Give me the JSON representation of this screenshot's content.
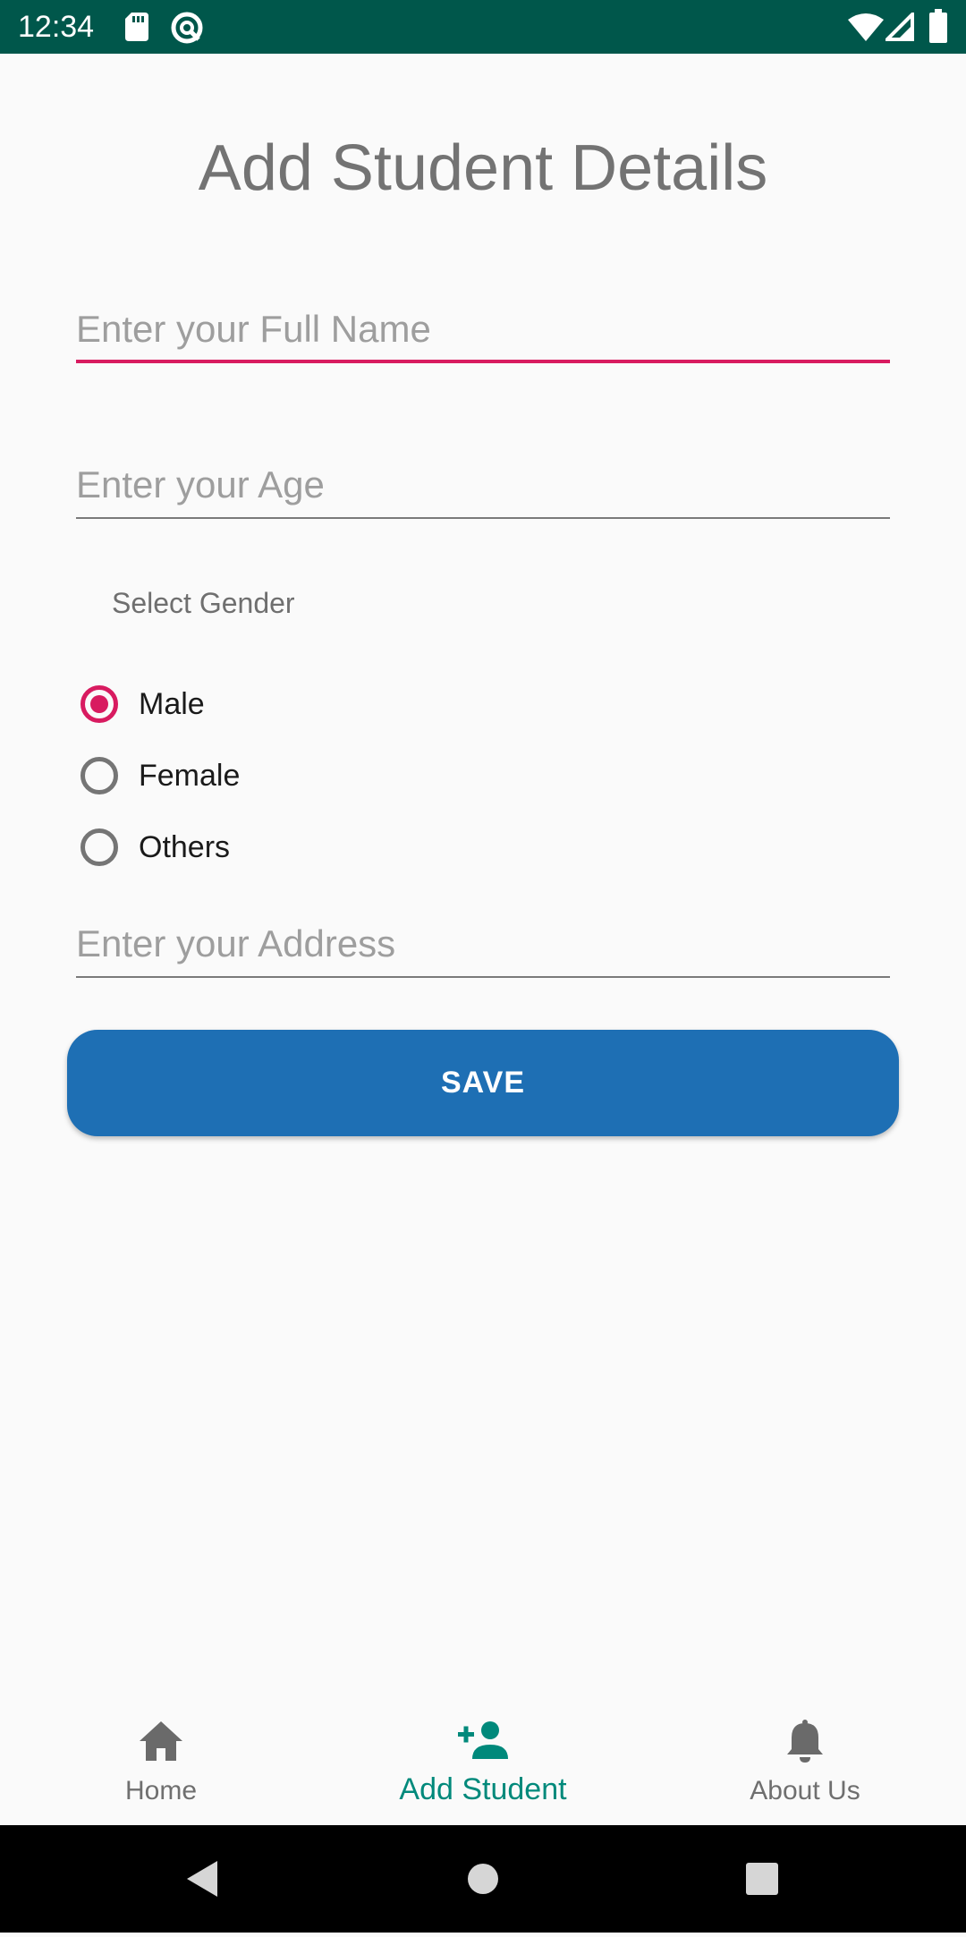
{
  "status_bar": {
    "time": "12:34",
    "icons": [
      "sd-card-icon",
      "vpn-icon",
      "wifi-icon",
      "signal-icon",
      "battery-icon"
    ]
  },
  "form": {
    "title": "Add Student Details",
    "full_name_placeholder": "Enter your Full Name",
    "age_placeholder": "Enter your Age",
    "gender_label": "Select Gender",
    "gender_options": [
      {
        "label": "Male",
        "checked": true
      },
      {
        "label": "Female",
        "checked": false
      },
      {
        "label": "Others",
        "checked": false
      }
    ],
    "address_placeholder": "Enter your Address",
    "save_label": "SAVE"
  },
  "bottom_nav": {
    "items": [
      {
        "label": "Home",
        "icon": "home-icon",
        "active": false
      },
      {
        "label": "Add Student",
        "icon": "person-add-icon",
        "active": true
      },
      {
        "label": "About Us",
        "icon": "bell-icon",
        "active": false
      }
    ]
  },
  "colors": {
    "status_bar": "#00574b",
    "accent": "#d81b60",
    "button": "#1e6fb4",
    "nav_active": "#00897b"
  }
}
